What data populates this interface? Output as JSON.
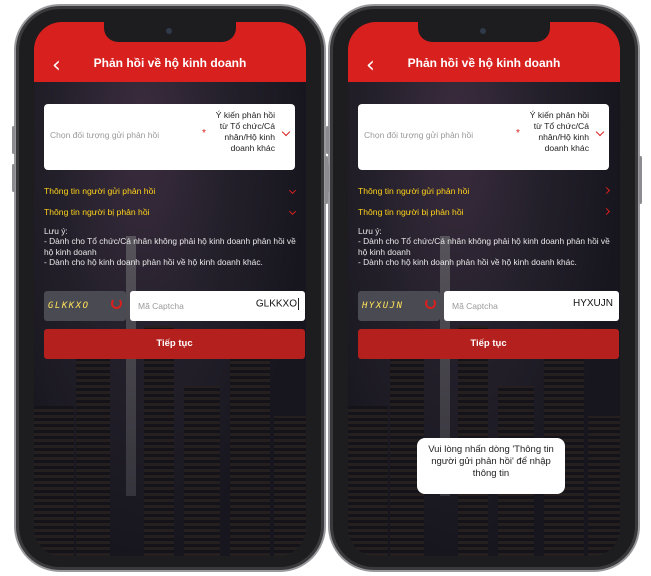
{
  "colors": {
    "header": "#d8201e",
    "link": "#ffd21a",
    "button": "#b3201d",
    "captcha_text": "#ffe35a"
  },
  "icons": {
    "back": "back-arrow-icon",
    "dropdown": "chevron-down-icon",
    "refresh": "refresh-icon"
  },
  "phones": [
    {
      "header": {
        "back_glyph": "‹",
        "title": "Phản hồi về hộ kinh doanh"
      },
      "select": {
        "placeholder": "Chọn đối tượng gửi phản hồi",
        "required_mark": "*",
        "value": "Ý kiến phản hồi từ Tổ chức/Cá nhân/Hộ kinh doanh khác"
      },
      "links": [
        {
          "label": "Thông tin người gửi phản hồi",
          "arrow": "down"
        },
        {
          "label": "Thông tin người bị phản hồi",
          "arrow": "down"
        }
      ],
      "note": {
        "heading": "Lưu ý:",
        "line1": "- Dành cho Tổ chức/Cá nhân không phải hộ kinh doanh phản hồi về hộ kinh doanh",
        "line2": "- Dành cho hộ kinh doanh phản hồi về hộ kinh doanh khác."
      },
      "captcha": {
        "image_text": "GLKKXO",
        "placeholder": "Mã Captcha",
        "value": "GLKKXO",
        "focused": true
      },
      "continue_label": "Tiếp tục"
    },
    {
      "header": {
        "back_glyph": "‹",
        "title": "Phản hồi về hộ kinh doanh"
      },
      "select": {
        "placeholder": "Chọn đối tượng gửi phản hồi",
        "required_mark": "*",
        "value": "Ý kiến phản hồi từ Tổ chức/Cá nhân/Hộ kinh doanh khác"
      },
      "links": [
        {
          "label": "Thông tin người gửi phản hồi",
          "arrow": "right"
        },
        {
          "label": "Thông tin người bị phản hồi",
          "arrow": "right"
        }
      ],
      "note": {
        "heading": "Lưu ý:",
        "line1": "- Dành cho Tổ chức/Cá nhân không phải hộ kinh doanh phản hồi về hộ kinh doanh",
        "line2": "- Dành cho hộ kinh doanh phản hồi về hộ kinh doanh khác."
      },
      "captcha": {
        "image_text": "HYXUJN",
        "placeholder": "Mã Captcha",
        "value": "HYXUJN",
        "focused": false
      },
      "continue_label": "Tiếp tục",
      "toast": "Vui lòng nhấn dòng 'Thông tin người gửi phản hồi' để nhập thông tin"
    }
  ]
}
